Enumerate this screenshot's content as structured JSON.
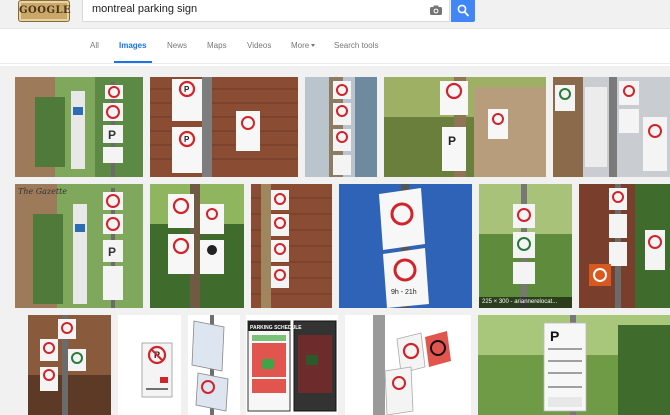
{
  "search": {
    "query": "montreal parking sign"
  },
  "tabs": [
    {
      "label": "All"
    },
    {
      "label": "Images"
    },
    {
      "label": "News"
    },
    {
      "label": "Maps"
    },
    {
      "label": "Videos"
    },
    {
      "label": "More"
    },
    {
      "label": "Search tools"
    }
  ],
  "results": {
    "caption_r2_5": "225 × 300 - ariannerelocat...",
    "schedule_title": "PARKING SCHEDULE"
  },
  "colors": {
    "accent": "#4285f4",
    "active_tab": "#1a73e8",
    "logo": "#c9a86a"
  },
  "icons": [
    "doodle-logo",
    "camera-icon",
    "search-icon",
    "chevron-down-icon"
  ]
}
